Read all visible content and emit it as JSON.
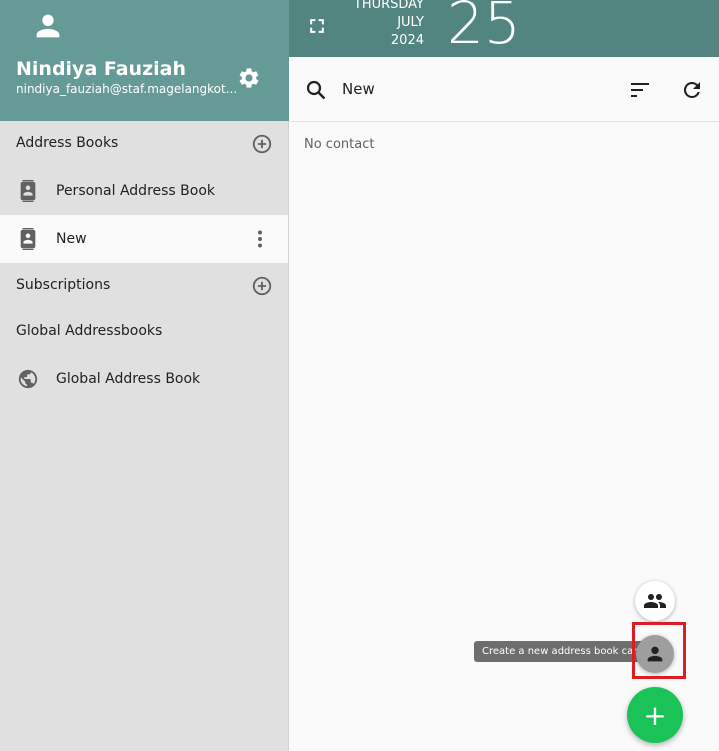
{
  "user": {
    "name": "Nindiya Fauziah",
    "email": "nindiya_fauziah@staf.magelangkot..."
  },
  "sidebar": {
    "address_books_label": "Address Books",
    "items": [
      {
        "label": "Personal Address Book",
        "icon": "contact-book-icon"
      },
      {
        "label": "New",
        "icon": "contact-book-icon",
        "selected": true
      }
    ],
    "subscriptions_label": "Subscriptions",
    "global_label": "Global Addressbooks",
    "global_items": [
      {
        "label": "Global Address Book",
        "icon": "globe-icon"
      }
    ]
  },
  "date": {
    "weekday": "THURSDAY",
    "month": "JULY",
    "year": "2024",
    "day": "25"
  },
  "toolbar": {
    "title": "New"
  },
  "content": {
    "empty_text": "No contact"
  },
  "fab": {
    "tooltip": "Create a new address book card",
    "add_symbol": "+"
  },
  "colors": {
    "header_accent": "#669a97",
    "date_bar": "#538580",
    "fab_add": "#1ac257",
    "highlight": "#e01b24"
  }
}
